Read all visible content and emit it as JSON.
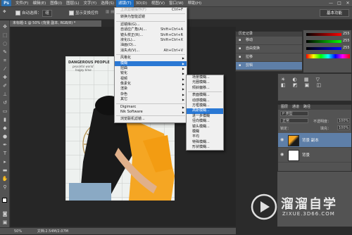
{
  "menubar": {
    "logo": "Ps",
    "items": [
      "文件(F)",
      "编辑(E)",
      "图像(I)",
      "图层(L)",
      "文字(Y)",
      "选择(S)",
      "滤镜(T)",
      "3D(D)",
      "视图(V)",
      "窗口(W)",
      "帮助(H)"
    ],
    "active_index": 6,
    "win_buttons": [
      "—",
      "□",
      "✕"
    ]
  },
  "optbar": {
    "auto_select_label": "自动选择：",
    "auto_select_value": "组",
    "transform_label": "显示变换控件"
  },
  "basic_button": "基本功能",
  "doc_tab": "未标题-1 @ 50% (背景 副本, RGB/8) *",
  "filter_menu": {
    "items": [
      {
        "label": "上次滤镜操作(F)",
        "shortcut": "Ctrl+F",
        "dim": true
      },
      {
        "sep": true
      },
      {
        "label": "转换为智能滤镜"
      },
      {
        "sep": true
      },
      {
        "label": "滤镜库(G)..."
      },
      {
        "label": "自适应广角(A)...",
        "shortcut": "Shift+Ctrl+A"
      },
      {
        "label": "镜头校正(R)...",
        "shortcut": "Shift+Ctrl+R"
      },
      {
        "label": "液化(L)...",
        "shortcut": "Shift+Ctrl+X"
      },
      {
        "label": "油画(O)..."
      },
      {
        "label": "消失点(V)...",
        "shortcut": "Alt+Ctrl+V"
      },
      {
        "sep": true
      },
      {
        "label": "风格化",
        "sub": true
      },
      {
        "label": "模糊",
        "sub": true,
        "hi": true
      },
      {
        "label": "扭曲",
        "sub": true
      },
      {
        "label": "锐化",
        "sub": true
      },
      {
        "label": "视频",
        "sub": true
      },
      {
        "label": "像素化",
        "sub": true
      },
      {
        "label": "渲染",
        "sub": true
      },
      {
        "label": "杂色",
        "sub": true
      },
      {
        "label": "其它",
        "sub": true
      },
      {
        "sep": true
      },
      {
        "label": "Digimarc",
        "sub": true
      },
      {
        "label": "Nik Software",
        "sub": true
      },
      {
        "sep": true
      },
      {
        "label": "浏览联机滤镜..."
      }
    ]
  },
  "blur_menu": {
    "items": [
      {
        "label": "场景模糊..."
      },
      {
        "label": "光圈模糊..."
      },
      {
        "label": "倾斜偏移..."
      },
      {
        "sep": true
      },
      {
        "label": "表面模糊..."
      },
      {
        "label": "动感模糊..."
      },
      {
        "label": "方框模糊..."
      },
      {
        "label": "高斯模糊...",
        "hi": true
      },
      {
        "label": "进一步模糊"
      },
      {
        "label": "径向模糊..."
      },
      {
        "label": "镜头模糊..."
      },
      {
        "label": "模糊"
      },
      {
        "label": "平均"
      },
      {
        "label": "特殊模糊..."
      },
      {
        "label": "形状模糊..."
      }
    ]
  },
  "history_panel": {
    "title": "历史记录",
    "items": [
      "移动",
      "自由变换",
      "拉移",
      "剪辑"
    ]
  },
  "color_panel": {
    "values": [
      "255",
      "255",
      "255"
    ]
  },
  "layers_panel": {
    "tabs": [
      "图层",
      "通道",
      "路径"
    ],
    "kind": "P 类型",
    "blend": "正常",
    "opacity_label": "不透明度：",
    "opacity": "100%",
    "lock_label": "锁定：",
    "fill_label": "填充：",
    "fill": "100%",
    "layers": [
      {
        "name": "背景 副本",
        "selected": true
      },
      {
        "name": "背景",
        "selected": false
      }
    ]
  },
  "photo": {
    "text1": "DANGEROUS PEOPLE",
    "text2": "peaceful world",
    "text3": "happy time"
  },
  "status": {
    "zoom": "50%",
    "doc": "文档:2.54M/2.07M"
  },
  "watermark": {
    "name": "溜溜自学",
    "url": "ZIXUE.3D66.COM"
  },
  "colors": {
    "accent": "#2a78d4",
    "orange": "#f5a623",
    "watermark": "#ffffff"
  }
}
